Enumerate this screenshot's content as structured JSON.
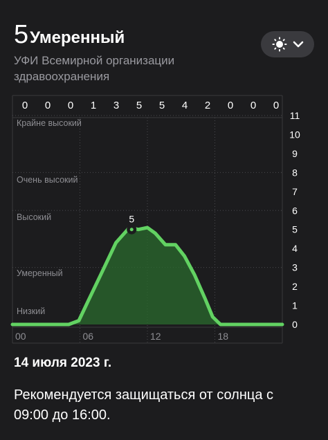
{
  "header": {
    "uv_value": "5",
    "uv_category": "Умеренный",
    "subtitle": "УФИ Всемирной организации здравоохранения"
  },
  "menu": {
    "icon": "sun-icon",
    "chevron": "chevron-down-icon"
  },
  "chart_data": {
    "type": "area",
    "hourly_values": [
      "0",
      "0",
      "0",
      "1",
      "3",
      "5",
      "5",
      "4",
      "2",
      "0",
      "0",
      "0"
    ],
    "band_labels": [
      "Крайне высокий",
      "Очень высокий",
      "Высокий",
      "Умеренный",
      "Низкий"
    ],
    "y_ticks": [
      "0",
      "1",
      "2",
      "3",
      "4",
      "5",
      "6",
      "7",
      "8",
      "9",
      "10",
      "11"
    ],
    "x_ticks": [
      "00",
      "06",
      "12",
      "18"
    ],
    "ylim": [
      0,
      11
    ],
    "xlim": [
      0,
      24
    ],
    "x": [
      0,
      5,
      5.9,
      6.7,
      8,
      9.2,
      10.4,
      11.2,
      12,
      12.7,
      13.6,
      14.5,
      15.3,
      16.2,
      17.1,
      17.8,
      18.5,
      24
    ],
    "y": [
      0,
      0,
      0.2,
      1.2,
      2.8,
      4.3,
      5.1,
      5.0,
      5.1,
      4.8,
      4.2,
      4.2,
      3.6,
      2.6,
      1.4,
      0.4,
      0,
      0
    ],
    "current_point": {
      "x": 10.6,
      "y": 5,
      "label": "5"
    },
    "line_color": "#62d262",
    "fill_color": "#2a6a2d"
  },
  "date": "14 июля 2023 г.",
  "recommendation": "Рекомендуется защищаться от солнца с 09:00 до 16:00."
}
